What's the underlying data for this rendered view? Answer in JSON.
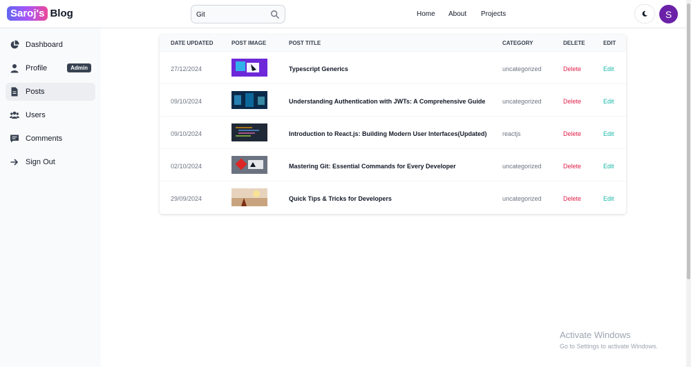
{
  "header": {
    "logo_badge": "Saroj's",
    "logo_text": "Blog",
    "search_value": "Git",
    "nav": [
      "Home",
      "About",
      "Projects"
    ],
    "avatar_initial": "S"
  },
  "sidebar": {
    "items": [
      {
        "label": "Dashboard",
        "icon": "pie-chart-icon"
      },
      {
        "label": "Profile",
        "icon": "user-icon",
        "badge": "Admin"
      },
      {
        "label": "Posts",
        "icon": "document-icon",
        "active": true
      },
      {
        "label": "Users",
        "icon": "users-icon"
      },
      {
        "label": "Comments",
        "icon": "comment-icon"
      },
      {
        "label": "Sign Out",
        "icon": "arrow-right-icon"
      }
    ]
  },
  "table": {
    "headers": [
      "DATE UPDATED",
      "POST IMAGE",
      "POST TITLE",
      "CATEGORY",
      "DELETE",
      "EDIT"
    ],
    "rows": [
      {
        "date": "27/12/2024",
        "title": "Typescript Generics",
        "category": "uncategorized",
        "delete": "Delete",
        "edit": "Edit"
      },
      {
        "date": "09/10/2024",
        "title": "Understanding Authentication with JWTs: A Comprehensive Guide",
        "category": "uncategorized",
        "delete": "Delete",
        "edit": "Edit"
      },
      {
        "date": "09/10/2024",
        "title": "Introduction to React.js: Building Modern User Interfaces(Updated)",
        "category": "reactjs",
        "delete": "Delete",
        "edit": "Edit"
      },
      {
        "date": "02/10/2024",
        "title": "Mastering Git: Essential Commands for Every Developer",
        "category": "uncategorized",
        "delete": "Delete",
        "edit": "Edit"
      },
      {
        "date": "29/09/2024",
        "title": "Quick Tips & Tricks for Developers",
        "category": "uncategorized",
        "delete": "Delete",
        "edit": "Edit"
      }
    ]
  },
  "watermark": {
    "line1": "Activate Windows",
    "line2": "Go to Settings to activate Windows."
  },
  "colors": {
    "delete": "#e11d48",
    "edit": "#14b8a6",
    "avatar": "#6b21a8"
  }
}
